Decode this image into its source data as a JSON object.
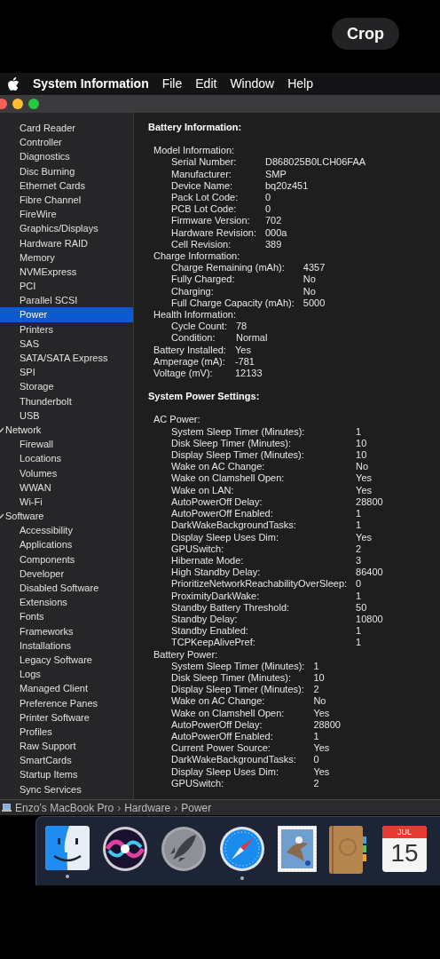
{
  "top_button": "Crop",
  "menu_bar": {
    "app": "System Information",
    "items": [
      "File",
      "Edit",
      "Window",
      "Help"
    ]
  },
  "sidebar": {
    "groups": [
      {
        "items": [
          {
            "label": "Card Reader",
            "selected": false
          },
          {
            "label": "Controller",
            "selected": false
          },
          {
            "label": "Diagnostics",
            "selected": false
          },
          {
            "label": "Disc Burning",
            "selected": false
          },
          {
            "label": "Ethernet Cards",
            "selected": false
          },
          {
            "label": "Fibre Channel",
            "selected": false
          },
          {
            "label": "FireWire",
            "selected": false
          },
          {
            "label": "Graphics/Displays",
            "selected": false
          },
          {
            "label": "Hardware RAID",
            "selected": false
          },
          {
            "label": "Memory",
            "selected": false
          },
          {
            "label": "NVMExpress",
            "selected": false
          },
          {
            "label": "PCI",
            "selected": false
          },
          {
            "label": "Parallel SCSI",
            "selected": false
          },
          {
            "label": "Power",
            "selected": true
          },
          {
            "label": "Printers",
            "selected": false
          },
          {
            "label": "SAS",
            "selected": false
          },
          {
            "label": "SATA/SATA Express",
            "selected": false
          },
          {
            "label": "SPI",
            "selected": false
          },
          {
            "label": "Storage",
            "selected": false
          },
          {
            "label": "Thunderbolt",
            "selected": false
          },
          {
            "label": "USB",
            "selected": false
          }
        ]
      },
      {
        "label": "Network",
        "expanded": true,
        "items": [
          {
            "label": "Firewall",
            "selected": false
          },
          {
            "label": "Locations",
            "selected": false
          },
          {
            "label": "Volumes",
            "selected": false
          },
          {
            "label": "WWAN",
            "selected": false
          },
          {
            "label": "Wi-Fi",
            "selected": false
          }
        ]
      },
      {
        "label": "Software",
        "expanded": true,
        "items": [
          {
            "label": "Accessibility",
            "selected": false
          },
          {
            "label": "Applications",
            "selected": false
          },
          {
            "label": "Components",
            "selected": false
          },
          {
            "label": "Developer",
            "selected": false
          },
          {
            "label": "Disabled Software",
            "selected": false
          },
          {
            "label": "Extensions",
            "selected": false
          },
          {
            "label": "Fonts",
            "selected": false
          },
          {
            "label": "Frameworks",
            "selected": false
          },
          {
            "label": "Installations",
            "selected": false
          },
          {
            "label": "Legacy Software",
            "selected": false
          },
          {
            "label": "Logs",
            "selected": false
          },
          {
            "label": "Managed Client",
            "selected": false
          },
          {
            "label": "Preference Panes",
            "selected": false
          },
          {
            "label": "Printer Software",
            "selected": false
          },
          {
            "label": "Profiles",
            "selected": false
          },
          {
            "label": "Raw Support",
            "selected": false
          },
          {
            "label": "SmartCards",
            "selected": false
          },
          {
            "label": "Startup Items",
            "selected": false
          },
          {
            "label": "Sync Services",
            "selected": false
          }
        ]
      }
    ]
  },
  "sections": [
    {
      "title": "Battery Information:",
      "children": [
        {
          "label": "Model Information:",
          "children": [
            {
              "label": "Serial Number:",
              "value": "D868025B0LCH06FAA"
            },
            {
              "label": "Manufacturer:",
              "value": "SMP"
            },
            {
              "label": "Device Name:",
              "value": "bq20z451"
            },
            {
              "label": "Pack Lot Code:",
              "value": "0"
            },
            {
              "label": "PCB Lot Code:",
              "value": "0"
            },
            {
              "label": "Firmware Version:",
              "value": "702"
            },
            {
              "label": "Hardware Revision:",
              "value": "000a"
            },
            {
              "label": "Cell Revision:",
              "value": "389"
            }
          ]
        },
        {
          "label": "Charge Information:",
          "children": [
            {
              "label": "Charge Remaining (mAh):",
              "value": "4357"
            },
            {
              "label": "Fully Charged:",
              "value": "No"
            },
            {
              "label": "Charging:",
              "value": "No"
            },
            {
              "label": "Full Charge Capacity (mAh):",
              "value": "5000"
            }
          ]
        },
        {
          "label": "Health Information:",
          "children": [
            {
              "label": "Cycle Count:",
              "value": "78"
            },
            {
              "label": "Condition:",
              "value": "Normal"
            }
          ]
        },
        {
          "label": "Battery Installed:",
          "value": "Yes"
        },
        {
          "label": "Amperage (mA):",
          "value": "-781"
        },
        {
          "label": "Voltage (mV):",
          "value": "12133"
        }
      ]
    },
    {
      "title": "System Power Settings:",
      "children": [
        {
          "label": "AC Power:",
          "children": [
            {
              "label": "System Sleep Timer (Minutes):",
              "value": "1"
            },
            {
              "label": "Disk Sleep Timer (Minutes):",
              "value": "10"
            },
            {
              "label": "Display Sleep Timer (Minutes):",
              "value": "10"
            },
            {
              "label": "Wake on AC Change:",
              "value": "No"
            },
            {
              "label": "Wake on Clamshell Open:",
              "value": "Yes"
            },
            {
              "label": "Wake on LAN:",
              "value": "Yes"
            },
            {
              "label": "AutoPowerOff Delay:",
              "value": "28800"
            },
            {
              "label": "AutoPowerOff Enabled:",
              "value": "1"
            },
            {
              "label": "DarkWakeBackgroundTasks:",
              "value": "1"
            },
            {
              "label": "Display Sleep Uses Dim:",
              "value": "Yes"
            },
            {
              "label": "GPUSwitch:",
              "value": "2"
            },
            {
              "label": "Hibernate Mode:",
              "value": "3"
            },
            {
              "label": "High Standby Delay:",
              "value": "86400"
            },
            {
              "label": "PrioritizeNetworkReachabilityOverSleep:",
              "value": "0"
            },
            {
              "label": "ProximityDarkWake:",
              "value": "1"
            },
            {
              "label": "Standby Battery Threshold:",
              "value": "50"
            },
            {
              "label": "Standby Delay:",
              "value": "10800"
            },
            {
              "label": "Standby Enabled:",
              "value": "1"
            },
            {
              "label": "TCPKeepAlivePref:",
              "value": "1"
            }
          ]
        },
        {
          "label": "Battery Power:",
          "children": [
            {
              "label": "System Sleep Timer (Minutes):",
              "value": "1"
            },
            {
              "label": "Disk Sleep Timer (Minutes):",
              "value": "10"
            },
            {
              "label": "Display Sleep Timer (Minutes):",
              "value": "2"
            },
            {
              "label": "Wake on AC Change:",
              "value": "No"
            },
            {
              "label": "Wake on Clamshell Open:",
              "value": "Yes"
            },
            {
              "label": "AutoPowerOff Delay:",
              "value": "28800"
            },
            {
              "label": "AutoPowerOff Enabled:",
              "value": "1"
            },
            {
              "label": "Current Power Source:",
              "value": "Yes"
            },
            {
              "label": "DarkWakeBackgroundTasks:",
              "value": "0"
            },
            {
              "label": "Display Sleep Uses Dim:",
              "value": "Yes"
            },
            {
              "label": "GPUSwitch:",
              "value": "2"
            }
          ]
        }
      ]
    }
  ],
  "status_bar": {
    "path": [
      "Enzo’s MacBook Pro",
      "Hardware",
      "Power"
    ],
    "separator": "›"
  },
  "dock": [
    {
      "kind": "finder",
      "running": true
    },
    {
      "kind": "siri",
      "running": false
    },
    {
      "kind": "launchpad",
      "running": false
    },
    {
      "kind": "safari",
      "running": true
    },
    {
      "kind": "mail",
      "running": false
    },
    {
      "kind": "contacts",
      "running": false
    },
    {
      "kind": "calendar",
      "running": false,
      "month": "JUL",
      "day": "15"
    }
  ]
}
